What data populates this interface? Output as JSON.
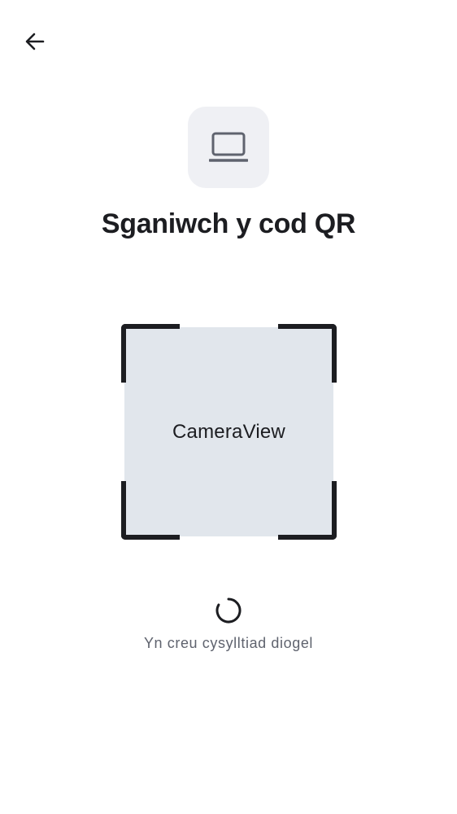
{
  "header": {
    "back_icon": "arrow-left-icon"
  },
  "device": {
    "icon": "laptop-icon"
  },
  "title": "Sganiwch y cod QR",
  "scanner": {
    "camera_label": "CameraView"
  },
  "status": {
    "spinner_icon": "loading-spinner-icon",
    "text": "Yn creu cysylltiad diogel"
  },
  "colors": {
    "text_primary": "#1c1d21",
    "text_secondary": "#5f636e",
    "tile_background": "#eff0f4",
    "camera_background": "#e1e6ec"
  }
}
